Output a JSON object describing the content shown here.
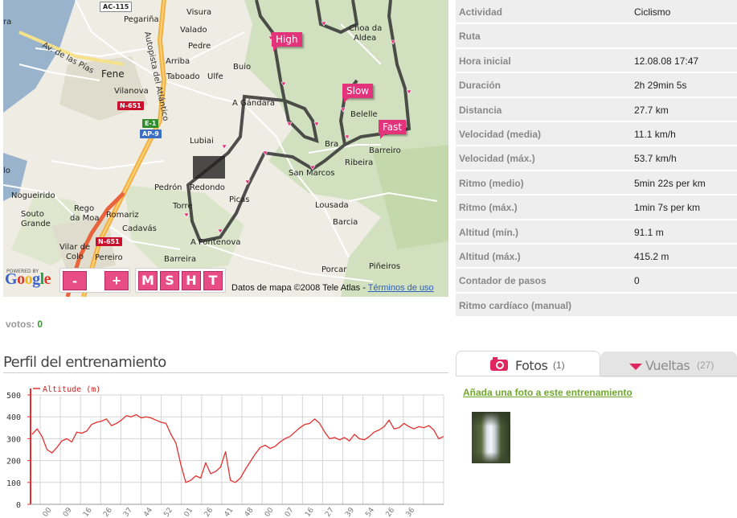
{
  "map": {
    "speed_tags": {
      "high": "High",
      "slow": "Slow",
      "fast": "Fast"
    },
    "places": [
      "Visura",
      "Pegariña",
      "Valado",
      "Pedre",
      "Arriba",
      "Taboado",
      "Ulfe",
      "Buio",
      "Fene",
      "Vilanova",
      "A Gándara",
      "Lubiai",
      "Pedrón",
      "Redondo",
      "Torre",
      "Picas",
      "Nogueirido",
      "Rego da Moa",
      "Souto Grande",
      "Romariz",
      "Cadavás",
      "A Fontenova",
      "Vilar de Colo",
      "Pereiro",
      "Barreira",
      "San Marcos",
      "Lousada",
      "Barcia",
      "Ribeira",
      "Barreiro",
      "Belelle",
      "Choa da Aldea",
      "Porcar",
      "Piñeiros",
      "Av. de las Pías",
      "Autopista del Atlántico",
      "Bra"
    ],
    "road_shields": [
      "AC-115",
      "N-651",
      "E-1",
      "AP-9",
      "N-651"
    ],
    "zoom_out_label": "-",
    "zoom_in_label": "+",
    "map_types": [
      "M",
      "S",
      "H",
      "T"
    ],
    "logo_powered": "POWERED BY",
    "logo": "Google",
    "credit_text": "Datos de mapa ©2008 Tele Atlas -",
    "terms_link": "Términos de uso"
  },
  "stats": [
    {
      "label": "Actividad",
      "value": "Ciclismo"
    },
    {
      "label": "Ruta",
      "value": ""
    },
    {
      "label": "Hora inicial",
      "value": "12.08.08 17:47"
    },
    {
      "label": "Duración",
      "value": "2h 29min 5s"
    },
    {
      "label": "Distancia",
      "value": "27.7 km"
    },
    {
      "label": "Velocidad (media)",
      "value": "11.1 km/h"
    },
    {
      "label": "Velocidad (máx.)",
      "value": "53.7 km/h"
    },
    {
      "label": "Ritmo (medio)",
      "value": "5min 22s per km"
    },
    {
      "label": "Ritmo (máx.)",
      "value": "1min 7s per km"
    },
    {
      "label": "Altitud (mín.)",
      "value": "91.1 m"
    },
    {
      "label": "Altitud (máx.)",
      "value": "415.2 m"
    },
    {
      "label": "Contador de pasos",
      "value": "0"
    },
    {
      "label": "Ritmo cardíaco (manual)",
      "value": ""
    }
  ],
  "votes": {
    "label": "votos:",
    "count": "0"
  },
  "profile": {
    "title": "Perfil del entrenamiento"
  },
  "tabs": {
    "fotos": {
      "label": "Fotos",
      "count": "(1)",
      "icon": "camera-icon"
    },
    "vueltas": {
      "label": "Vueltas",
      "count": "(27)",
      "icon": "triangle-down-icon"
    }
  },
  "add_photo_link": "Añada una foto a este entrenamiento",
  "chart_data": {
    "type": "line",
    "series": [
      {
        "name": "Altitude (m)",
        "color": "#e23030",
        "values": [
          320,
          345,
          310,
          250,
          235,
          260,
          290,
          300,
          285,
          330,
          325,
          335,
          365,
          375,
          380,
          390,
          360,
          370,
          385,
          405,
          400,
          410,
          395,
          400,
          395,
          385,
          375,
          370,
          320,
          280,
          180,
          100,
          110,
          130,
          120,
          190,
          140,
          150,
          170,
          240,
          110,
          100,
          120,
          160,
          195,
          230,
          260,
          270,
          255,
          265,
          285,
          300,
          310,
          330,
          350,
          365,
          370,
          390,
          370,
          330,
          300,
          305,
          295,
          305,
          290,
          320,
          300,
          295,
          310,
          330,
          340,
          355,
          385,
          345,
          350,
          370,
          355,
          345,
          355,
          350,
          360,
          340,
          300,
          310
        ]
      }
    ],
    "ylim": [
      0,
      500
    ],
    "yticks": [
      0,
      100,
      200,
      300,
      400,
      500
    ],
    "xtick_labels": [
      "00",
      "09",
      "16",
      "26",
      "37",
      "44",
      "52",
      "01",
      "26",
      "41",
      "48",
      "00",
      "07",
      "16",
      "27",
      "39",
      "54",
      "26",
      "36"
    ],
    "legend": "Altitude (m)",
    "legend_position": "top-left",
    "grid": true
  }
}
